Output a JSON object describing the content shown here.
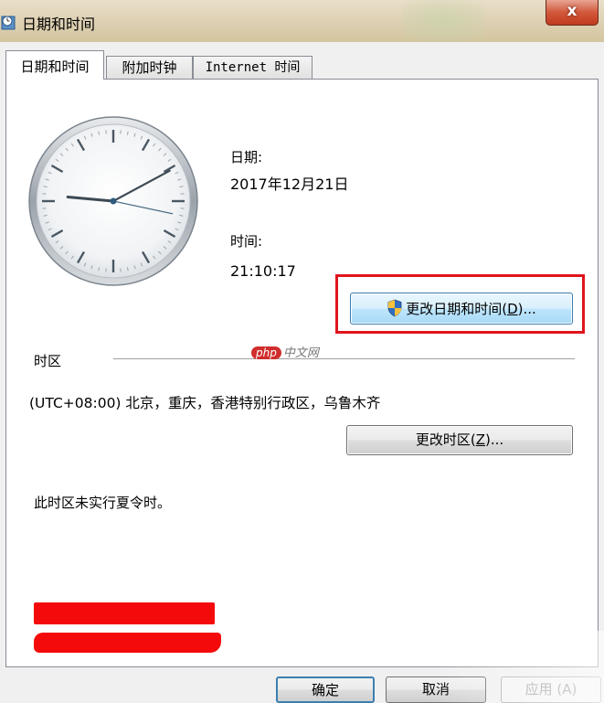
{
  "window": {
    "title": "日期和时间",
    "close_symbol": "x",
    "app_icon": "clock-app-icon"
  },
  "tabs": [
    {
      "label": "日期和时间",
      "active": true
    },
    {
      "label": "附加时钟",
      "active": false
    },
    {
      "label": "Internet 时间",
      "active": false
    }
  ],
  "datetime": {
    "date_label": "日期:",
    "date_value": "2017年12月21日",
    "time_label": "时间:",
    "time_value": "21:10:17",
    "change_button": {
      "text": "更改日期和时间(",
      "mnemonic": "D",
      "suffix": ")...",
      "icon": "uac-shield-icon"
    }
  },
  "timezone": {
    "section_label": "时区",
    "value": "(UTC+08:00) 北京，重庆，香港特别行政区，乌鲁木齐",
    "change_button": {
      "text": "更改时区(",
      "mnemonic": "Z",
      "suffix": ")..."
    },
    "dst_note": "此时区未实行夏令时。"
  },
  "watermark": {
    "badge": "php",
    "text": "中文网"
  },
  "footer": {
    "ok": "确定",
    "cancel": "取消",
    "apply": "应用 (A)"
  },
  "colors": {
    "highlight_border": "#e0141c",
    "redaction": "#f40a0a",
    "accent_blue": "#3c7fb1"
  },
  "clock": {
    "hours": 21,
    "minutes": 10,
    "seconds": 17
  }
}
